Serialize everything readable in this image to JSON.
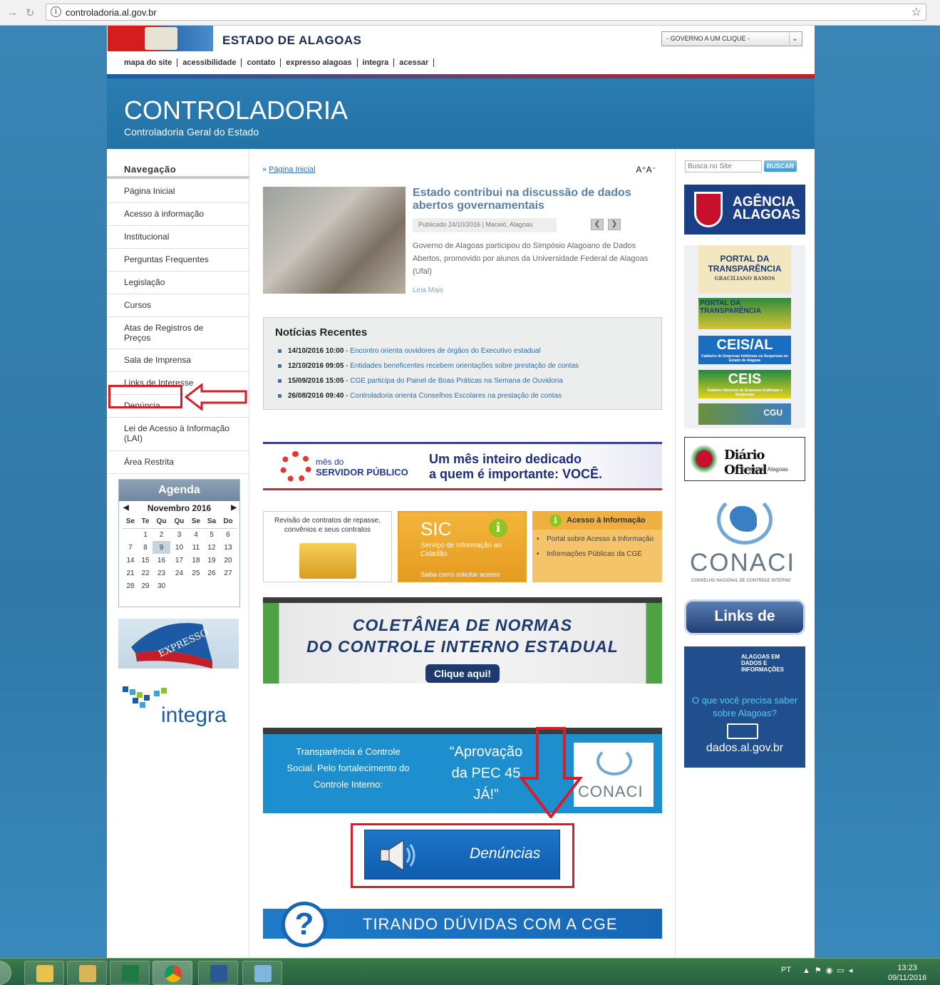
{
  "browser": {
    "url": "controladoria.al.gov.br"
  },
  "header": {
    "state_title": "ESTADO DE ALAGOAS",
    "gov_select": "- GOVERNO A UM CLIQUE -",
    "top_links": [
      "mapa do site",
      "acessibilidade",
      "contato",
      "expresso alagoas",
      "integra",
      "acessar"
    ],
    "site_title": "CONTROLADORIA",
    "site_subtitle": "Controladoria Geral do Estado"
  },
  "sidebar": {
    "title": "Navegação",
    "items": [
      {
        "label": "Página Inicial"
      },
      {
        "label": "Acesso à informação"
      },
      {
        "label": "Institucional"
      },
      {
        "label": "Perguntas Frequentes"
      },
      {
        "label": "Legislação"
      },
      {
        "label": "Cursos"
      },
      {
        "label": "Atas de Registros de Preços"
      },
      {
        "label": "Sala de Imprensa"
      },
      {
        "label": "Links de Interesse"
      },
      {
        "label": "Denúncia"
      },
      {
        "label": "Lei de Acesso à Informação (LAI)"
      },
      {
        "label": "Área Restrita"
      }
    ],
    "agenda": {
      "title": "Agenda",
      "month": "Novembro 2016",
      "weekdays": [
        "Se",
        "Te",
        "Qu",
        "Qu",
        "Se",
        "Sa",
        "Do"
      ],
      "weeks": [
        [
          "",
          "1",
          "2",
          "3",
          "4",
          "5",
          "6"
        ],
        [
          "7",
          "8",
          "9",
          "10",
          "11",
          "12",
          "13"
        ],
        [
          "14",
          "15",
          "16",
          "17",
          "18",
          "19",
          "20"
        ],
        [
          "21",
          "22",
          "23",
          "24",
          "25",
          "26",
          "27"
        ],
        [
          "28",
          "29",
          "30",
          "",
          "",
          "",
          ""
        ]
      ],
      "today": "9"
    },
    "expresso_label": "EXPRESSO",
    "integra_label": "integra"
  },
  "main": {
    "breadcrumb_prefix": "»",
    "breadcrumb": "Página Inicial",
    "font_size_control": "A⁺A⁻",
    "featured": {
      "title": "Estado contribui na discussão de dados abertos governamentais",
      "meta": "Publicado 24/10/2016 | Maceió, Alagoas",
      "description": "Governo de Alagoas participou do Simpósio Alagoano de Dados Abertos, promovido por alunos da Universidade Federal de Alagoas (Ufal)",
      "read_more": "Leia Mais"
    },
    "news": {
      "title": "Notícias Recentes",
      "items": [
        {
          "date": "14/10/2016 10:00",
          "text": "Encontro orienta ouvidores de órgãos do Executivo estadual"
        },
        {
          "date": "12/10/2016 09:05",
          "text": "Entidades beneficentes recebem orientações sobre prestação de contas"
        },
        {
          "date": "15/09/2016 15:05",
          "text": "CGE participa do Painel de Boas Práticas na Semana de Ouvidoria"
        },
        {
          "date": "26/08/2016 09:40",
          "text": "Controladoria orienta Conselhos Escolares na prestação de contas"
        }
      ]
    },
    "servidor_banner": {
      "line1": "mês do",
      "line2": "SERVIDOR PÚBLICO",
      "headline1": "Um mês inteiro dedicado",
      "headline2": "a quem é importante: VOCÊ."
    },
    "box_contratos": "Revisão de contratos de repasse, convênios e seus contratos",
    "box_sic": {
      "title": "SIC",
      "subtitle": "Serviço de Informação ao Cidadão",
      "footer": "Saiba como solicitar acesso"
    },
    "box_acesso": {
      "title": "Acesso à Informação",
      "items": [
        "Portal sobre Acesso à Informação",
        "Informações Públicas da CGE"
      ]
    },
    "coletanea": {
      "line1": "COLETÂNEA DE NORMAS",
      "line2": "DO CONTROLE INTERNO ESTADUAL",
      "button": "Clique aqui!"
    },
    "pec_banner": {
      "left": "Transparência é Controle Social. Pelo fortalecimento do Controle Interno:",
      "quote": "“Aprovação da PEC 45 JÁ!”",
      "logo": "CONACI"
    },
    "denuncias_button": "Denúncias",
    "tirando_duvidas": "TIRANDO DÚVIDAS COM A CGE"
  },
  "right": {
    "search_placeholder": "Busca no Site",
    "search_button": "BUSCAR",
    "agencia": "AGÊNCIA ALAGOAS",
    "portal_transparencia": {
      "title": "PORTAL DA TRANSPARÊNCIA",
      "subtitle": "GRACILIANO RAMOS"
    },
    "portal_transparencia_federal": "PORTAL DA TRANSPARÊNCIA",
    "ceis_al": {
      "title": "CEIS/AL",
      "subtitle": "Cadastro de Empresas Inidôneas ou Suspensas no Estado de Alagoas"
    },
    "ceis": {
      "title": "CEIS",
      "subtitle": "Cadastro Nacional de Empresas Inidôneas e Suspensas"
    },
    "cgu": "CGU",
    "diario_oficial": {
      "title": "Diário Oficial",
      "subtitle": "Estado de Alagoas"
    },
    "conaci": {
      "title": "CONACI",
      "subtitle": "CONSELHO NACIONAL DE CONTROLE INTERNO"
    },
    "links_interesse": "Links de Interesse",
    "dados": {
      "top": "ALAGOAS EM DADOS E INFORMAÇÕES",
      "question": "O que você precisa saber sobre Alagoas?",
      "url": "dados.al.gov.br"
    }
  },
  "taskbar": {
    "language": "PT",
    "time": "13:23",
    "date": "09/11/2016"
  },
  "colors": {
    "banner": "#2a7cb2",
    "highlight": "#d71e28",
    "link": "#2b6fb0"
  }
}
